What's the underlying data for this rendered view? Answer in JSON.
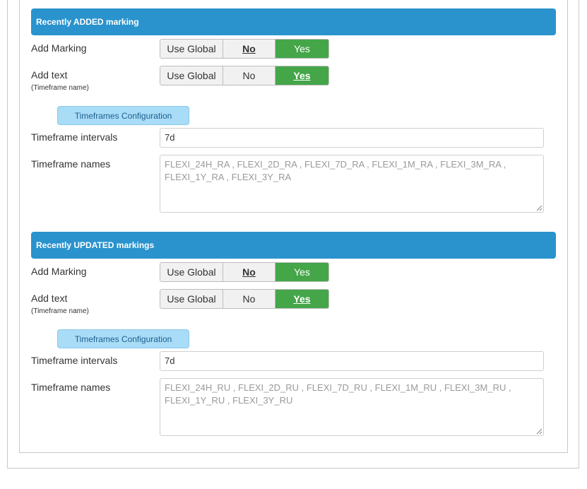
{
  "sections": [
    {
      "title": "Recently ADDED marking",
      "add_marking": {
        "label": "Add Marking",
        "options": [
          "Use Global",
          "No",
          "Yes"
        ],
        "selected": "Yes",
        "emphasized": "No"
      },
      "add_text": {
        "label": "Add text",
        "sublabel": "(Timeframe name)",
        "options": [
          "Use Global",
          "No",
          "Yes"
        ],
        "selected": "Yes",
        "emphasized": "Yes"
      },
      "config_button": "Timeframes Configuration",
      "intervals": {
        "label": "Timeframe intervals",
        "value": "7d"
      },
      "names": {
        "label": "Timeframe names",
        "placeholder": "FLEXI_24H_RA , FLEXI_2D_RA , FLEXI_7D_RA , FLEXI_1M_RA , FLEXI_3M_RA , FLEXI_1Y_RA , FLEXI_3Y_RA"
      }
    },
    {
      "title": "Recently UPDATED markings",
      "add_marking": {
        "label": "Add Marking",
        "options": [
          "Use Global",
          "No",
          "Yes"
        ],
        "selected": "Yes",
        "emphasized": "No"
      },
      "add_text": {
        "label": "Add text",
        "sublabel": "(Timeframe name)",
        "options": [
          "Use Global",
          "No",
          "Yes"
        ],
        "selected": "Yes",
        "emphasized": "Yes"
      },
      "config_button": "Timeframes Configuration",
      "intervals": {
        "label": "Timeframe intervals",
        "value": "7d"
      },
      "names": {
        "label": "Timeframe names",
        "placeholder": "FLEXI_24H_RU , FLEXI_2D_RU , FLEXI_7D_RU , FLEXI_1M_RU , FLEXI_3M_RU , FLEXI_1Y_RU , FLEXI_3Y_RU"
      }
    }
  ],
  "colors": {
    "header": "#2a93cd",
    "active": "#44a649",
    "config_button": "#a9dcf7"
  }
}
